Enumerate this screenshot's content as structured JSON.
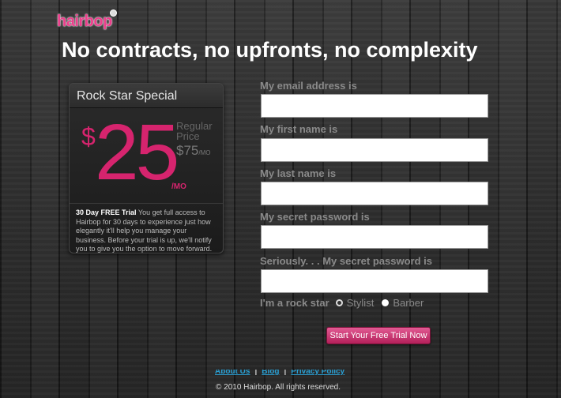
{
  "brand": {
    "logo_text": "hairbop"
  },
  "headline": "No contracts, no upfronts, no complexity",
  "pricing_card": {
    "title": "Rock Star Special",
    "currency": "$",
    "amount": "25",
    "per_month": "/MO",
    "regular_label": "Regular Price",
    "regular_price": "$75",
    "regular_per": "/MO",
    "trial_title": "30 Day FREE Trial",
    "trial_text": "You get full access to Hairbop for 30 days to experience just how elegantly it'll help you manage your business. Before your trial is up, we'll notify you to give you the option to move forward."
  },
  "form": {
    "email_label": "My email address is",
    "first_name_label": "My first name is",
    "last_name_label": "My last name is",
    "password_label": "My secret password is",
    "confirm_password_label": "Seriously. . . My secret password is",
    "email_value": "",
    "first_name_value": "",
    "last_name_value": "",
    "password_value": "",
    "confirm_password_value": "",
    "role_label": "I'm a rock star",
    "role_options": [
      "Stylist",
      "Barber"
    ],
    "submit_label": "Start Your Free Trial Now"
  },
  "footer": {
    "links": [
      "About Us",
      "Blog",
      "Privacy Policy"
    ],
    "separator": "|",
    "copyright": "© 2010 Hairbop. All rights reserved."
  },
  "colors": {
    "brand_pink": "#d6246e",
    "link_blue": "#2aa0d4",
    "label_gray": "#8a8a8a"
  }
}
